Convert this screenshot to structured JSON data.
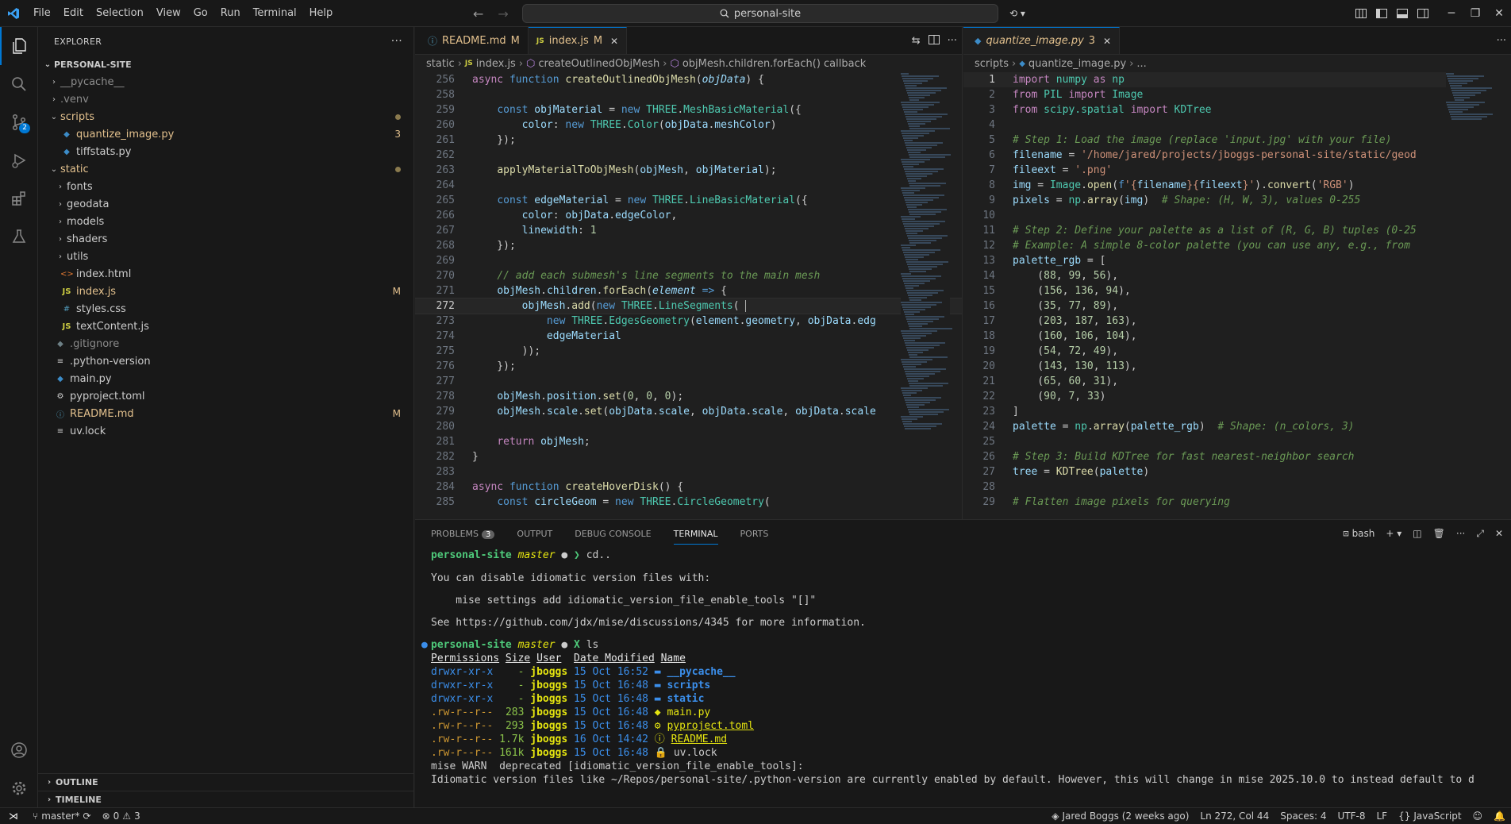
{
  "menu": [
    "File",
    "Edit",
    "Selection",
    "View",
    "Go",
    "Run",
    "Terminal",
    "Help"
  ],
  "search": {
    "label": "personal-site"
  },
  "explorer": {
    "title": "EXPLORER",
    "root": "PERSONAL-SITE",
    "items": [
      {
        "name": "__pycache__",
        "kind": "folder-closed",
        "depth": 1,
        "muted": true
      },
      {
        "name": ".venv",
        "kind": "folder-closed",
        "depth": 1,
        "muted": true
      },
      {
        "name": "scripts",
        "kind": "folder-open",
        "depth": 1,
        "color": "#e2c08d",
        "deco": "dot"
      },
      {
        "name": "quantize_image.py",
        "kind": "py",
        "depth": 2,
        "color": "#e2c08d",
        "deco": "3"
      },
      {
        "name": "tiffstats.py",
        "kind": "py",
        "depth": 2
      },
      {
        "name": "static",
        "kind": "folder-open",
        "depth": 1,
        "color": "#e2c08d",
        "deco": "dot"
      },
      {
        "name": "fonts",
        "kind": "folder-closed",
        "depth": 2
      },
      {
        "name": "geodata",
        "kind": "folder-closed",
        "depth": 2
      },
      {
        "name": "models",
        "kind": "folder-closed",
        "depth": 2
      },
      {
        "name": "shaders",
        "kind": "folder-closed",
        "depth": 2
      },
      {
        "name": "utils",
        "kind": "folder-closed",
        "depth": 2
      },
      {
        "name": "index.html",
        "kind": "html",
        "depth": 2
      },
      {
        "name": "index.js",
        "kind": "js",
        "depth": 2,
        "color": "#e2c08d",
        "deco": "M"
      },
      {
        "name": "styles.css",
        "kind": "css",
        "depth": 2
      },
      {
        "name": "textContent.js",
        "kind": "js",
        "depth": 2
      },
      {
        "name": ".gitignore",
        "kind": "git",
        "depth": 1,
        "muted": true
      },
      {
        "name": ".python-version",
        "kind": "txt",
        "depth": 1
      },
      {
        "name": "main.py",
        "kind": "py",
        "depth": 1
      },
      {
        "name": "pyproject.toml",
        "kind": "toml",
        "depth": 1
      },
      {
        "name": "README.md",
        "kind": "md",
        "depth": 1,
        "color": "#e2c08d",
        "deco": "M"
      },
      {
        "name": "uv.lock",
        "kind": "txt",
        "depth": 1
      }
    ],
    "outline": "OUTLINE",
    "timeline": "TIMELINE"
  },
  "editor_left": {
    "tabs": [
      {
        "label": "README.md",
        "flag": "M",
        "active": false,
        "icon": "md"
      },
      {
        "label": "index.js",
        "flag": "M",
        "active": true,
        "icon": "js"
      }
    ],
    "breadcrumb": [
      "static",
      "index.js",
      "createOutlinedObjMesh",
      "objMesh.children.forEach() callback"
    ]
  },
  "editor_right": {
    "tabs": [
      {
        "label": "quantize_image.py",
        "flag": "3",
        "active": true,
        "icon": "py"
      }
    ],
    "breadcrumb": [
      "scripts",
      "quantize_image.py",
      "..."
    ]
  },
  "panel": {
    "tabs": [
      "PROBLEMS",
      "OUTPUT",
      "DEBUG CONSOLE",
      "TERMINAL",
      "PORTS"
    ],
    "problems_count": "3",
    "shell": "bash",
    "terminal": {
      "prompt1": {
        "dir": "personal-site",
        "branch": "master",
        "cmd": "cd.."
      },
      "msg1": "You can disable idiomatic version files with:",
      "msg2": "    mise settings add idiomatic_version_file_enable_tools \"[]\"",
      "msg3": "See https://github.com/jdx/mise/discussions/4345 for more information.",
      "prompt2": {
        "dir": "personal-site",
        "branch": "master",
        "cmd": "ls"
      },
      "headers": [
        "Permissions",
        "Size",
        "User",
        "Date Modified",
        "Name"
      ],
      "rows": [
        {
          "perm": "drwxr-xr-x",
          "size": "-",
          "user": "jboggs",
          "date": "15 Oct 16:52",
          "name": "__pycache__",
          "type": "dir"
        },
        {
          "perm": "drwxr-xr-x",
          "size": "-",
          "user": "jboggs",
          "date": "15 Oct 16:48",
          "name": "scripts",
          "type": "dir"
        },
        {
          "perm": "drwxr-xr-x",
          "size": "-",
          "user": "jboggs",
          "date": "15 Oct 16:48",
          "name": "static",
          "type": "dir"
        },
        {
          "perm": ".rw-r--r--",
          "size": "283",
          "user": "jboggs",
          "date": "15 Oct 16:48",
          "name": "main.py",
          "type": "py"
        },
        {
          "perm": ".rw-r--r--",
          "size": "293",
          "user": "jboggs",
          "date": "15 Oct 16:48",
          "name": "pyproject.toml",
          "type": "toml"
        },
        {
          "perm": ".rw-r--r--",
          "size": "1.7k",
          "user": "jboggs",
          "date": "16 Oct 14:42",
          "name": "README.md",
          "type": "md"
        },
        {
          "perm": ".rw-r--r--",
          "size": "161k",
          "user": "jboggs",
          "date": "15 Oct 16:48",
          "name": "uv.lock",
          "type": "lock"
        }
      ],
      "warn1": "mise WARN  deprecated [idiomatic_version_file_enable_tools]:",
      "warn2": "Idiomatic version files like ~/Repos/personal-site/.python-version are currently enabled by default. However, this will change in mise 2025.10.0 to instead default to d"
    }
  },
  "status": {
    "branch": "master*",
    "errors": "0",
    "warnings": "3",
    "blame": "Jared Boggs (2 weeks ago)",
    "position": "Ln 272, Col 44",
    "spaces": "Spaces: 4",
    "encoding": "UTF-8",
    "eol": "LF",
    "language": "JavaScript"
  },
  "colors": {
    "accent": "#0078d4",
    "modified": "#e2c08d",
    "background": "#1f1f1f"
  }
}
